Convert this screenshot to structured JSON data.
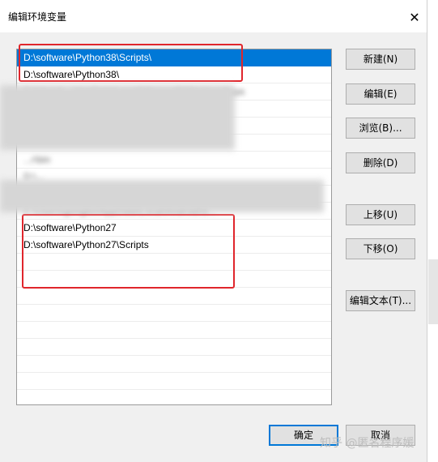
{
  "window": {
    "title": "编辑环境变量",
    "close_glyph": "✕"
  },
  "path_list": {
    "rows": [
      {
        "text": "D:\\software\\Python38\\Scripts\\",
        "selected": true,
        "blurred": false
      },
      {
        "text": "D:\\software\\Python38\\",
        "selected": false,
        "blurred": false
      },
      {
        "text": "C:\\Users\\...\\AppData\\Local\\Microsoft\\WindowsApps",
        "selected": false,
        "blurred": true
      },
      {
        "text": "",
        "selected": false,
        "blurred": true
      },
      {
        "text": "",
        "selected": false,
        "blurred": true
      },
      {
        "text": "",
        "selected": false,
        "blurred": true
      },
      {
        "text": "...r\\bin",
        "selected": false,
        "blurred": true
      },
      {
        "text": "D:\\...",
        "selected": false,
        "blurred": true
      },
      {
        "text": "",
        "selected": false,
        "blurred": true
      },
      {
        "text": "C:\\Users\\gongbo\\AppData\\Local\\Android\\S...",
        "selected": false,
        "blurred": true
      },
      {
        "text": "D:\\software\\Python27",
        "selected": false,
        "blurred": false
      },
      {
        "text": "D:\\software\\Python27\\Scripts",
        "selected": false,
        "blurred": false
      },
      {
        "text": "",
        "selected": false,
        "blurred": false
      },
      {
        "text": "",
        "selected": false,
        "blurred": false
      },
      {
        "text": "",
        "selected": false,
        "blurred": false
      },
      {
        "text": "",
        "selected": false,
        "blurred": false
      },
      {
        "text": "",
        "selected": false,
        "blurred": false
      },
      {
        "text": "",
        "selected": false,
        "blurred": false
      },
      {
        "text": "",
        "selected": false,
        "blurred": false
      },
      {
        "text": "",
        "selected": false,
        "blurred": false
      },
      {
        "text": "",
        "selected": false,
        "blurred": false
      }
    ]
  },
  "buttons": {
    "new": "新建(N)",
    "edit": "编辑(E)",
    "browse": "浏览(B)...",
    "delete": "删除(D)",
    "move_up": "上移(U)",
    "move_down": "下移(O)",
    "edit_text": "编辑文本(T)...",
    "ok": "确定",
    "cancel": "取消"
  },
  "watermark": "知乎 @匿名程序媛",
  "colors": {
    "selection": "#0078d7",
    "highlight_box": "#e0262c"
  }
}
